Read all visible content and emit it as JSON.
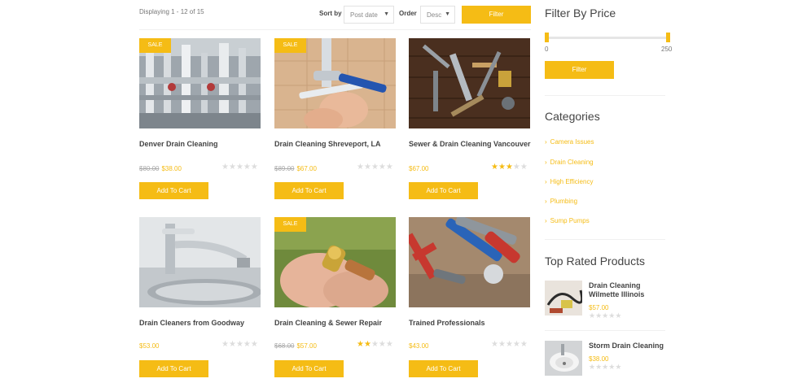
{
  "toolbar": {
    "displaying": "Displaying 1 - 12 of 15",
    "sort_label": "Sort by",
    "sort_value": "Post date",
    "order_label": "Order",
    "order_value": "Desc",
    "filter_label": "Filter"
  },
  "products": [
    {
      "title": "Denver Drain Cleaning",
      "old_price": "$80.00",
      "price": "$38.00",
      "sale": "SALE",
      "rating": 0,
      "cart": "Add To Cart",
      "image": "pipes-photo"
    },
    {
      "title": "Drain Cleaning Shreveport, LA",
      "old_price": "$89.00",
      "price": "$67.00",
      "sale": "SALE",
      "rating": 0,
      "cart": "Add To Cart",
      "image": "wrench-faucet-photo"
    },
    {
      "title": "Sewer & Drain Cleaning Vancouver",
      "old_price": "",
      "price": "$67.00",
      "sale": "",
      "rating": 3,
      "cart": "Add To Cart",
      "image": "tools-photo"
    },
    {
      "title": "Drain Cleaners from Goodway",
      "old_price": "",
      "price": "$53.00",
      "sale": "",
      "rating": 0,
      "cart": "Add To Cart",
      "image": "faucet-photo"
    },
    {
      "title": "Drain Cleaning & Sewer Repair",
      "old_price": "$68.00",
      "price": "$57.00",
      "sale": "SALE",
      "rating": 2,
      "cart": "Add To Cart",
      "image": "copper-fitting-photo"
    },
    {
      "title": "Trained Professionals",
      "old_price": "",
      "price": "$43.00",
      "sale": "",
      "rating": 0,
      "cart": "Add To Cart",
      "image": "wrenches-photo"
    }
  ],
  "sidebar": {
    "price_filter": {
      "heading": "Filter By Price",
      "min": "0",
      "max": "250",
      "button": "Filter"
    },
    "categories": {
      "heading": "Categories",
      "items": [
        "Camera Issues",
        "Drain Cleaning",
        "High Efficiency",
        "Plumbing",
        "Sump Pumps"
      ]
    },
    "top_rated": {
      "heading": "Top Rated Products",
      "items": [
        {
          "name": "Drain Cleaning Wilmette Illinois",
          "price": "$57.00",
          "rating": 0,
          "image": "hose-photo"
        },
        {
          "name": "Storm Drain Cleaning",
          "price": "$38.00",
          "rating": 0,
          "image": "sink-photo"
        }
      ]
    }
  },
  "colors": {
    "accent": "#f5bc15",
    "text": "#444444",
    "muted": "#777777"
  }
}
